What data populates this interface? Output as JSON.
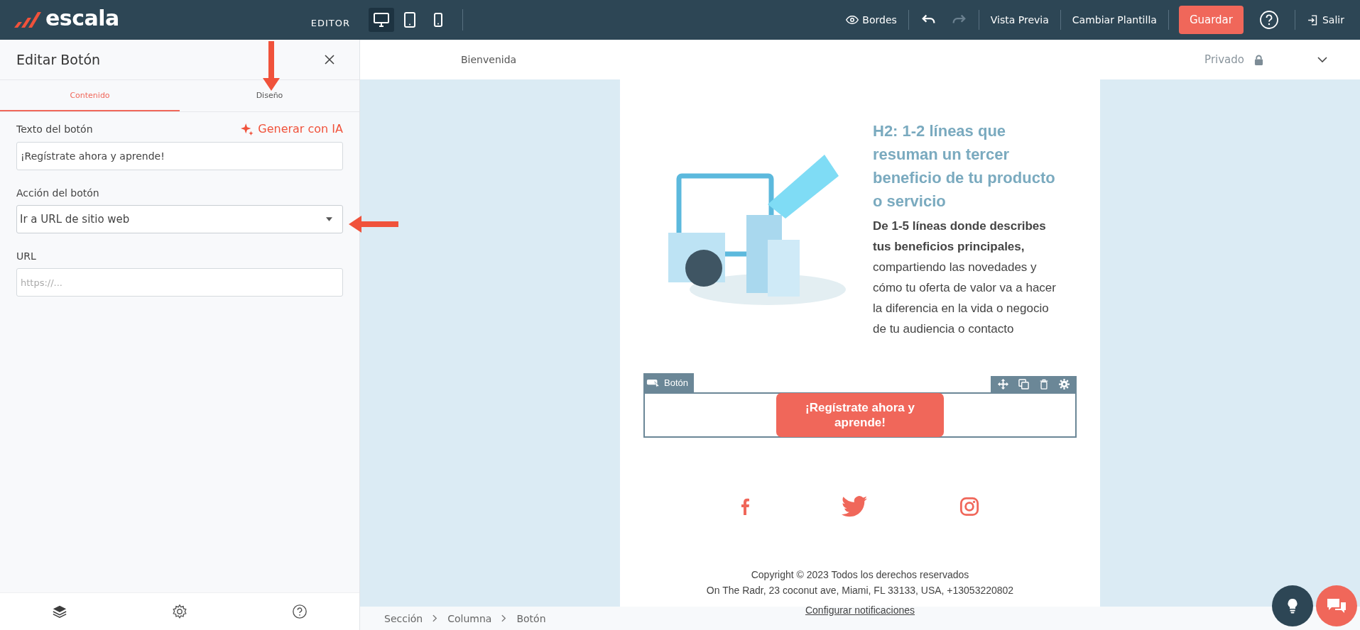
{
  "topbar": {
    "logo": "escala",
    "mode": "EDITOR",
    "devices": [
      {
        "kind": "desktop",
        "selected": true
      },
      {
        "kind": "tablet",
        "selected": false
      },
      {
        "kind": "mobile",
        "selected": false
      }
    ],
    "borders": "Bordes",
    "undo": {
      "disabled": false
    },
    "redo": {
      "disabled": true
    },
    "preview": "Vista Previa",
    "change_template": "Cambiar Plantilla",
    "save": "Guardar",
    "exit": "Salir"
  },
  "panel": {
    "title": "Editar Botón",
    "tabs": [
      {
        "label": "Contenido",
        "selected": true
      },
      {
        "label": "Diseño",
        "selected": false
      }
    ],
    "fields": [
      {
        "kind": "text",
        "label": "Texto del botón",
        "action": "Generar con IA",
        "value": "¡Regístrate ahora y aprende!"
      },
      {
        "kind": "select",
        "label": "Acción del botón",
        "value": "Ir a URL de sitio web"
      },
      {
        "kind": "text",
        "label": "URL",
        "placeholder": "https://..."
      }
    ]
  },
  "page_bar": {
    "name": "Bienvenida",
    "visibility": "Privado"
  },
  "email": {
    "heading": "H2: 1-2 líneas que resuman un tercer beneficio de tu producto o servicio",
    "body": "**De 1-5 líneas donde describes tus beneficios principales,**\ncompartiendo las novedades y cómo tu oferta de valor va a hacer la diferencia en la vida o negocio de tu audiencia o contacto",
    "block_label": "Botón",
    "button": "¡Regístrate ahora y aprende!",
    "copyright": "Copyright © 2023 Todos los derechos reservados",
    "address": "On The Radr, 23 coconut ave, Miami, FL 33133, USA, +13053220802",
    "link": "Configurar notificaciones"
  },
  "breadcrumb": [
    "Sección",
    "Columna",
    "Botón"
  ]
}
